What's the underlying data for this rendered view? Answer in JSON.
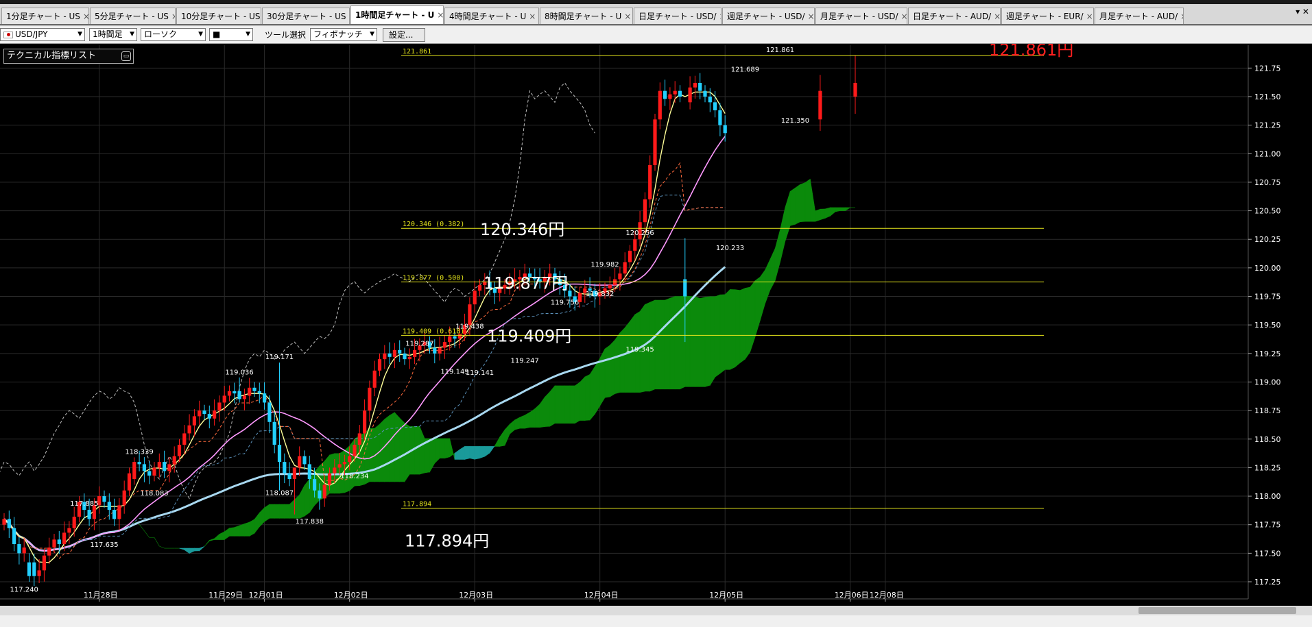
{
  "tabs": [
    {
      "label": "1分足チャート - US"
    },
    {
      "label": "5分足チャート - US"
    },
    {
      "label": "10分足チャート - US"
    },
    {
      "label": "30分足チャート - US"
    },
    {
      "label": "1時間足チャート - U",
      "active": true
    },
    {
      "label": "4時間足チャート - U"
    },
    {
      "label": "8時間足チャート - U"
    },
    {
      "label": "日足チャート - USD/"
    },
    {
      "label": "週足チャート - USD/"
    },
    {
      "label": "月足チャート - USD/"
    },
    {
      "label": "日足チャート - AUD/"
    },
    {
      "label": "週足チャート - EUR/"
    },
    {
      "label": "月足チャート - AUD/"
    }
  ],
  "tab_controls": "▾ ✕",
  "toolbar": {
    "pair": "USD/JPY",
    "timeframe": "1時間足",
    "chart_type": "ローソク",
    "style": "■",
    "tool_label": "ツール選択",
    "tool": "フィボナッチ",
    "settings_button": "設定..."
  },
  "indicator_panel": {
    "label": "テクニカル指標リスト",
    "icon": "collapse-icon"
  },
  "colors": {
    "background": "#000000",
    "grid": "#2b2b2b",
    "bull": "#ff1a1a",
    "bear": "#23d0ff",
    "fib": "#e7e71c",
    "cloud_bull": "#0b8a0b",
    "cloud_bear": "#1a9a9a",
    "sma_short": "#ffff99",
    "sma_mid": "#ff99ff",
    "sma_long": "#a8d8f0",
    "tenkan": "#ff6a3d",
    "kijun": "#5a8fb8",
    "chikou": "#bdbdbd",
    "high_label": "#ff2020"
  },
  "chart_data": {
    "type": "candlestick",
    "ylim": [
      117.1,
      121.95
    ],
    "y_ticks": [
      "117.25",
      "117.50",
      "117.75",
      "118.00",
      "118.25",
      "118.50",
      "118.75",
      "119.00",
      "119.25",
      "119.50",
      "119.75",
      "120.00",
      "120.25",
      "120.50",
      "120.75",
      "121.00",
      "121.25",
      "121.50",
      "121.75"
    ],
    "date_labels": [
      {
        "label": "11月28日",
        "bar": 19
      },
      {
        "label": "11月29日",
        "bar": 44
      },
      {
        "label": "12月01日",
        "bar": 52
      },
      {
        "label": "12月02日",
        "bar": 69
      },
      {
        "label": "12月03日",
        "bar": 94
      },
      {
        "label": "12月04日",
        "bar": 119
      },
      {
        "label": "12月05日",
        "bar": 144
      },
      {
        "label": "12月06日",
        "bar": 169
      },
      {
        "label": "12月08日",
        "bar": 176
      }
    ],
    "closes": [
      117.8,
      117.72,
      117.58,
      117.5,
      117.55,
      117.42,
      117.3,
      117.35,
      117.48,
      117.55,
      117.62,
      117.58,
      117.68,
      117.72,
      117.82,
      117.95,
      117.88,
      117.8,
      117.92,
      118.0,
      117.95,
      117.88,
      117.8,
      117.92,
      118.05,
      118.2,
      118.3,
      118.28,
      118.22,
      118.18,
      118.25,
      118.3,
      118.22,
      118.28,
      118.35,
      118.45,
      118.55,
      118.62,
      118.7,
      118.75,
      118.72,
      118.68,
      118.75,
      118.82,
      118.88,
      118.92,
      118.9,
      118.85,
      118.88,
      118.95,
      118.92,
      118.9,
      118.82,
      118.65,
      118.45,
      118.3,
      118.2,
      118.15,
      118.25,
      118.35,
      118.28,
      118.15,
      118.05,
      117.98,
      118.1,
      118.2,
      118.25,
      118.28,
      118.3,
      118.35,
      118.45,
      118.55,
      118.75,
      118.95,
      119.1,
      119.2,
      119.25,
      119.22,
      119.28,
      119.25,
      119.2,
      119.22,
      119.28,
      119.32,
      119.35,
      119.3,
      119.25,
      119.3,
      119.35,
      119.4,
      119.38,
      119.42,
      119.5,
      119.68,
      119.8,
      119.85,
      119.88,
      119.82,
      119.78,
      119.82,
      119.85,
      119.88,
      119.9,
      119.92,
      119.95,
      119.92,
      119.9,
      119.88,
      119.92,
      119.95,
      119.9,
      119.85,
      119.8,
      119.75,
      119.7,
      119.78,
      119.82,
      119.8,
      119.75,
      119.78,
      119.82,
      119.85,
      119.9,
      119.95,
      120.05,
      120.15,
      120.25,
      120.4,
      120.6,
      120.9,
      121.3,
      121.55,
      121.48,
      121.52,
      121.55,
      121.5,
      121.45,
      121.58,
      121.62,
      121.55,
      121.5,
      121.45,
      121.38,
      121.25,
      121.18
    ],
    "bars_override": [
      {
        "i": 5,
        "o": 117.42,
        "h": 117.5,
        "l": 117.25,
        "c": 117.3
      },
      {
        "i": 26,
        "o": 118.15,
        "h": 118.34,
        "l": 118.1,
        "c": 118.3
      },
      {
        "i": 47,
        "o": 118.92,
        "h": 119.04,
        "l": 118.82,
        "c": 118.85
      },
      {
        "i": 55,
        "o": 118.45,
        "h": 119.17,
        "l": 118.05,
        "c": 118.3
      },
      {
        "i": 58,
        "o": 118.15,
        "h": 118.25,
        "l": 117.84,
        "c": 118.25
      },
      {
        "i": 90,
        "o": 119.4,
        "h": 119.44,
        "l": 119.3,
        "c": 119.38
      },
      {
        "i": 136,
        "o": 119.9,
        "h": 120.26,
        "l": 119.35,
        "c": 119.75
      },
      {
        "i": 163,
        "o": 121.3,
        "h": 121.69,
        "l": 121.2,
        "c": 121.55
      },
      {
        "i": 170,
        "o": 121.5,
        "h": 121.86,
        "l": 121.35,
        "c": 121.62
      }
    ],
    "price_labels": [
      {
        "text": "117.240",
        "bar": 4,
        "price": 117.24,
        "pos": "below"
      },
      {
        "text": "117.885",
        "bar": 16,
        "price": 117.885,
        "pos": "above"
      },
      {
        "text": "117.635",
        "bar": 20,
        "price": 117.635,
        "pos": "below"
      },
      {
        "text": "118.339",
        "bar": 27,
        "price": 118.339,
        "pos": "above"
      },
      {
        "text": "118.083",
        "bar": 30,
        "price": 118.083,
        "pos": "below"
      },
      {
        "text": "119.036",
        "bar": 47,
        "price": 119.036,
        "pos": "above"
      },
      {
        "text": "119.171",
        "bar": 55,
        "price": 119.171,
        "pos": "above"
      },
      {
        "text": "118.087",
        "bar": 55,
        "price": 118.087,
        "pos": "below"
      },
      {
        "text": "117.838",
        "bar": 61,
        "price": 117.838,
        "pos": "below"
      },
      {
        "text": "118.234",
        "bar": 70,
        "price": 118.234,
        "pos": "below"
      },
      {
        "text": "119.287",
        "bar": 83,
        "price": 119.287,
        "pos": "above"
      },
      {
        "text": "119.149",
        "bar": 90,
        "price": 119.149,
        "pos": "below"
      },
      {
        "text": "119.438",
        "bar": 93,
        "price": 119.438,
        "pos": "above"
      },
      {
        "text": "119.141",
        "bar": 95,
        "price": 119.141,
        "pos": "below"
      },
      {
        "text": "119.247",
        "bar": 104,
        "price": 119.247,
        "pos": "below"
      },
      {
        "text": "119.756",
        "bar": 112,
        "price": 119.756,
        "pos": "below"
      },
      {
        "text": "119.982",
        "bar": 120,
        "price": 119.982,
        "pos": "above"
      },
      {
        "text": "119.832",
        "bar": 119,
        "price": 119.832,
        "pos": "below"
      },
      {
        "text": "120.256",
        "bar": 127,
        "price": 120.256,
        "pos": "above"
      },
      {
        "text": "119.345",
        "bar": 127,
        "price": 119.345,
        "pos": "below"
      },
      {
        "text": "120.233",
        "bar": 145,
        "price": 120.233,
        "pos": "below"
      },
      {
        "text": "121.689",
        "bar": 148,
        "price": 121.689,
        "pos": "above"
      },
      {
        "text": "121.861",
        "bar": 155,
        "price": 121.861,
        "pos": "above"
      },
      {
        "text": "121.350",
        "bar": 158,
        "price": 121.35,
        "pos": "below"
      }
    ],
    "fib_levels": [
      {
        "price": 121.861,
        "label": "121.861",
        "big": "121.861円",
        "big_color": "red"
      },
      {
        "price": 120.346,
        "label": "120.346 (0.382)",
        "big": "120.346円"
      },
      {
        "price": 119.877,
        "label": "119.877 (0.500)",
        "big": "119.877円"
      },
      {
        "price": 119.409,
        "label": "119.409 (0.618)",
        "big": "119.409円"
      },
      {
        "price": 117.894,
        "label": "117.894",
        "big": "117.894円"
      }
    ]
  }
}
